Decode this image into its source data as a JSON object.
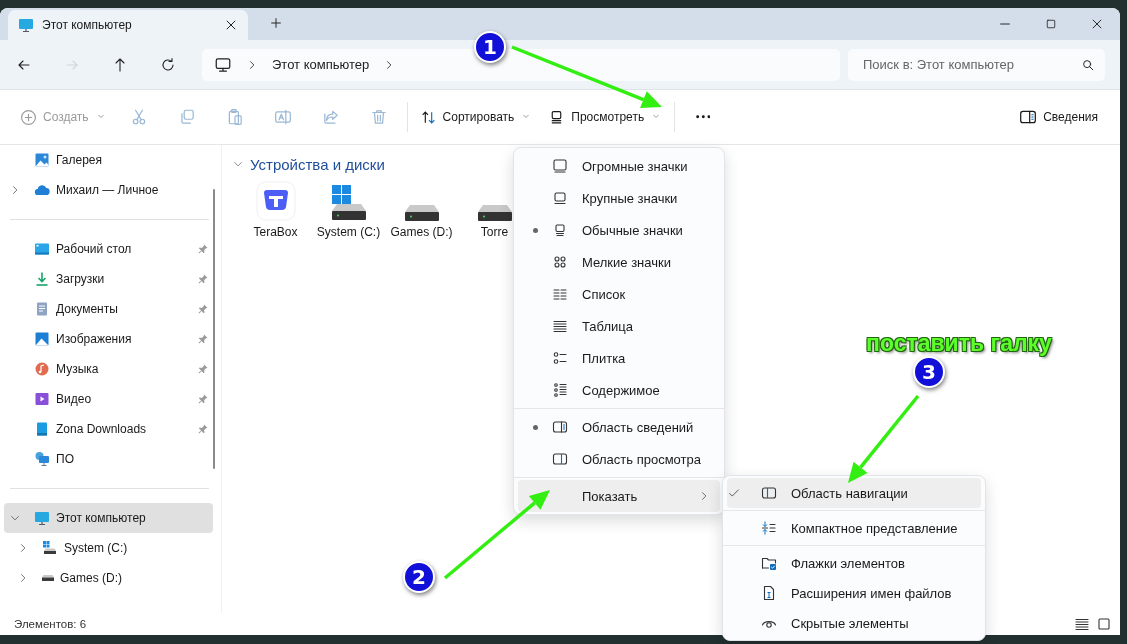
{
  "window": {
    "tab_title": "Этот компьютер"
  },
  "nav_buttons": [
    {
      "kind": "back",
      "disabled": false
    },
    {
      "kind": "forward",
      "disabled": true
    },
    {
      "kind": "up",
      "disabled": false
    },
    {
      "kind": "refresh",
      "disabled": false
    }
  ],
  "address": {
    "path": [
      "Этот компьютер"
    ]
  },
  "search": {
    "placeholder": "Поиск в: Этот компьютер"
  },
  "toolbar": {
    "groups": [
      [
        {
          "kind": "new",
          "label": "Создать",
          "disabled": true,
          "dropdown": true
        },
        {
          "kind": "cut",
          "disabled": true
        },
        {
          "kind": "copy",
          "disabled": true
        },
        {
          "kind": "paste",
          "disabled": true
        },
        {
          "kind": "rename",
          "disabled": true
        },
        {
          "kind": "share",
          "disabled": true
        },
        {
          "kind": "delete",
          "disabled": true
        }
      ],
      [
        {
          "kind": "sort",
          "label": "Сортировать",
          "disabled": false,
          "dropdown": true
        },
        {
          "kind": "view",
          "label": "Просмотреть",
          "disabled": false,
          "dropdown": true
        }
      ],
      [
        {
          "kind": "more",
          "disabled": false
        }
      ]
    ],
    "details": {
      "label": "Сведения"
    }
  },
  "sidebar": {
    "sections": [
      [
        {
          "kind": "gallery",
          "label": "Галерея",
          "selected": false
        },
        {
          "kind": "cloud",
          "label": "Михаил — Личное",
          "expanded": false,
          "selected": false
        }
      ],
      [
        {
          "kind": "desktop",
          "label": "Рабочий стол",
          "pinned": true,
          "selected": false
        },
        {
          "kind": "download",
          "label": "Загрузки",
          "pinned": true,
          "selected": false
        },
        {
          "kind": "documents",
          "label": "Документы",
          "pinned": true,
          "selected": false
        },
        {
          "kind": "pictures",
          "label": "Изображения",
          "pinned": true,
          "selected": false
        },
        {
          "kind": "music",
          "label": "Музыка",
          "pinned": true,
          "selected": false
        },
        {
          "kind": "video",
          "label": "Видео",
          "pinned": true,
          "selected": false
        },
        {
          "kind": "folder",
          "label": "Zona Downloads",
          "pinned": true,
          "selected": false
        },
        {
          "kind": "network",
          "label": "ПО",
          "pinned": false,
          "selected": false
        }
      ],
      [
        {
          "kind": "pc",
          "label": "Этот компьютер",
          "expanded": true,
          "selected": true,
          "children": [
            {
              "kind": "system-drive",
              "label": "System (C:)",
              "expanded": false,
              "selected": false
            },
            {
              "kind": "drive",
              "label": "Games (D:)",
              "expanded": false,
              "selected": false
            }
          ]
        }
      ]
    ]
  },
  "content": {
    "groups": [
      {
        "title": "Устройства и диски",
        "expanded": true,
        "items": [
          {
            "kind": "terabox",
            "label": "TeraBox"
          },
          {
            "kind": "system-drive",
            "label": "System (C:)"
          },
          {
            "kind": "drive",
            "label": "Games (D:)"
          },
          {
            "kind": "drive",
            "label": "Torre"
          }
        ]
      }
    ]
  },
  "status_bar": {
    "text": "Элементов: 6",
    "views": [
      {
        "kind": "details"
      },
      {
        "kind": "tiles"
      }
    ]
  },
  "view_menu": {
    "sections": [
      [
        {
          "kind": "huge",
          "label": "Огромные значки",
          "selected": false,
          "highlighted": false
        },
        {
          "kind": "large",
          "label": "Крупные значки",
          "selected": false,
          "highlighted": false
        },
        {
          "kind": "medium",
          "label": "Обычные значки",
          "selected": true,
          "highlighted": false
        },
        {
          "kind": "small",
          "label": "Мелкие значки",
          "selected": false,
          "highlighted": false
        },
        {
          "kind": "list",
          "label": "Список",
          "selected": false,
          "highlighted": false
        },
        {
          "kind": "table",
          "label": "Таблица",
          "selected": false,
          "highlighted": false
        },
        {
          "kind": "tiles",
          "label": "Плитка",
          "selected": false,
          "highlighted": false
        },
        {
          "kind": "contents",
          "label": "Содержимое",
          "selected": false,
          "highlighted": false
        }
      ],
      [
        {
          "kind": "details-pane",
          "label": "Область сведений",
          "selected": true,
          "highlighted": false
        },
        {
          "kind": "preview-pane",
          "label": "Область просмотра",
          "selected": false,
          "highlighted": false
        }
      ],
      [
        {
          "kind": "show",
          "label": "Показать",
          "submenu": true,
          "highlighted": true
        }
      ]
    ]
  },
  "show_submenu": {
    "sections": [
      [
        {
          "kind": "nav-pane",
          "label": "Область навигации",
          "checked": true,
          "highlighted": true
        }
      ],
      [
        {
          "kind": "compact",
          "label": "Компактное представление",
          "checked": false,
          "highlighted": false
        }
      ],
      [
        {
          "kind": "checkboxes",
          "label": "Флажки элементов",
          "checked": false,
          "highlighted": false
        },
        {
          "kind": "extensions",
          "label": "Расширения имен файлов",
          "checked": false,
          "highlighted": false
        },
        {
          "kind": "hidden",
          "label": "Скрытые элементы",
          "checked": false,
          "highlighted": false
        }
      ]
    ]
  },
  "annotations": [
    {
      "number": "1"
    },
    {
      "number": "2"
    },
    {
      "number": "3",
      "caption": "поставить галку"
    }
  ]
}
